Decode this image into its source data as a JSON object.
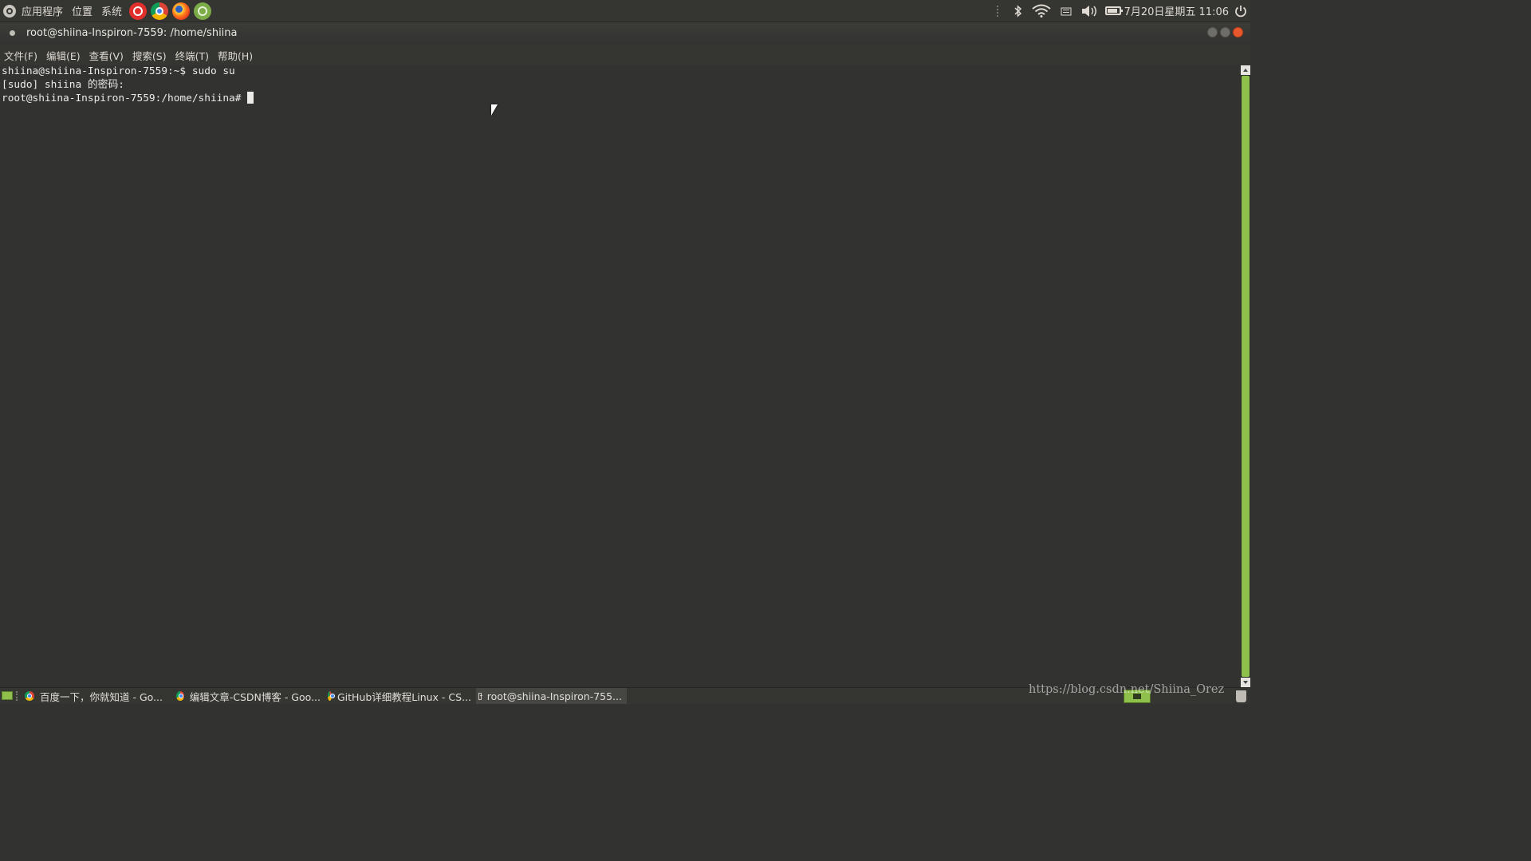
{
  "top_panel": {
    "menus": [
      "应用程序",
      "位置",
      "系统"
    ],
    "launchers": [
      "netease-music-icon",
      "chrome-icon",
      "firefox-icon",
      "ubuntu-software-icon"
    ],
    "tray_icons": [
      "bluetooth-icon",
      "wifi-icon",
      "keyboard-icon",
      "volume-icon",
      "battery-icon"
    ],
    "clock": "7月20日星期五 11:06"
  },
  "window": {
    "title": "root@shiina-Inspiron-7559: /home/shiina"
  },
  "menu_bar": {
    "items": [
      "文件(F)",
      "编辑(E)",
      "查看(V)",
      "搜索(S)",
      "终端(T)",
      "帮助(H)"
    ]
  },
  "terminal": {
    "lines": [
      "shiina@shiina-Inspiron-7559:~$ sudo su",
      "[sudo] shiina 的密码:",
      "root@shiina-Inspiron-7559:/home/shiina# "
    ]
  },
  "taskbar": {
    "tasks": [
      {
        "label": "百度一下，你就知道 - Go...",
        "icon": "chrome-icon"
      },
      {
        "label": "编辑文章-CSDN博客 - Goo...",
        "icon": "chrome-icon"
      },
      {
        "label": "GitHub详细教程Linux - CS...",
        "icon": "chrome-icon"
      },
      {
        "label": "root@shiina-Inspiron-755...",
        "icon": "terminal-icon"
      }
    ]
  },
  "watermark": "https://blog.csdn.net/Shiina_Orez",
  "colors": {
    "accent": "#8fc04b",
    "terminal_bg": "#323230",
    "close_button": "#e9572c"
  }
}
